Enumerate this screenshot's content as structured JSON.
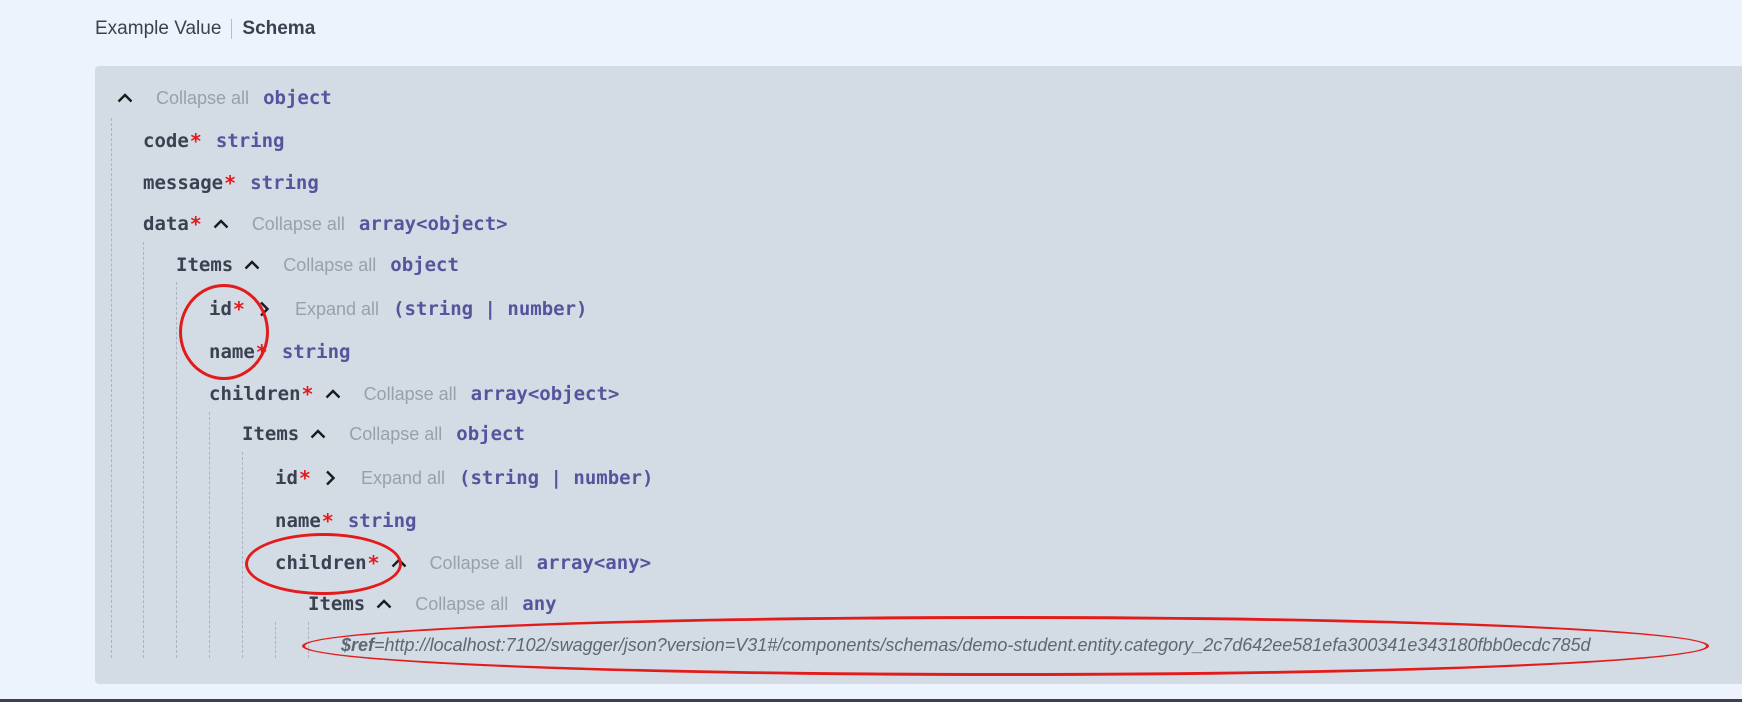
{
  "tabs": {
    "example_value": "Example Value",
    "schema": "Schema"
  },
  "schema": {
    "root": {
      "toggle": "Collapse all",
      "type": "object"
    },
    "code": {
      "name": "code",
      "required": "*",
      "type": "string"
    },
    "message": {
      "name": "message",
      "required": "*",
      "type": "string"
    },
    "data": {
      "name": "data",
      "required": "*",
      "toggle": "Collapse all",
      "type": "array<object>"
    },
    "data_items": {
      "name": "Items",
      "toggle": "Collapse all",
      "type": "object"
    },
    "item_id": {
      "name": "id",
      "required": "*",
      "toggle": "Expand all",
      "type": "(string | number)"
    },
    "item_name": {
      "name": "name",
      "required": "*",
      "type": "string"
    },
    "item_children": {
      "name": "children",
      "required": "*",
      "toggle": "Collapse all",
      "type": "array<object>"
    },
    "children_items": {
      "name": "Items",
      "toggle": "Collapse all",
      "type": "object"
    },
    "child_id": {
      "name": "id",
      "required": "*",
      "toggle": "Expand all",
      "type": "(string | number)"
    },
    "child_name": {
      "name": "name",
      "required": "*",
      "type": "string"
    },
    "child_children": {
      "name": "children",
      "required": "*",
      "toggle": "Collapse all",
      "type": "array<any>"
    },
    "grandchild_items": {
      "name": "Items",
      "toggle": "Collapse all",
      "type": "any"
    },
    "ref": {
      "key": "$ref",
      "value": "=http://localhost:7102/swagger/json?version=V31#/components/schemas/demo-student.entity.category_2c7d642ee581efa300341e343180fbb0ecdc785d"
    }
  },
  "icons": {
    "collapse": "chevron-up-icon",
    "expand": "chevron-right-icon"
  },
  "colors": {
    "background": "#ecf3fc",
    "panel": "#d3dbe5",
    "type": "#55559d",
    "required": "#e11b1b",
    "annotation": "#e31b1b"
  }
}
